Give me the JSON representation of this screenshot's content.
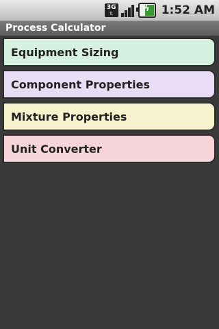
{
  "status_bar": {
    "network_type": "3G",
    "time": "1:52 AM"
  },
  "app": {
    "title": "Process Calculator"
  },
  "menu": {
    "items": [
      {
        "label": "Equipment Sizing",
        "color": "#d6f1e2"
      },
      {
        "label": "Component Properties",
        "color": "#e8ddf5"
      },
      {
        "label": "Mixture Properties",
        "color": "#f8f2cf"
      },
      {
        "label": "Unit Converter",
        "color": "#f7d4d9"
      }
    ]
  },
  "colors": {
    "background": "#3a3a3a",
    "title_bar": "#6b6b6b"
  }
}
